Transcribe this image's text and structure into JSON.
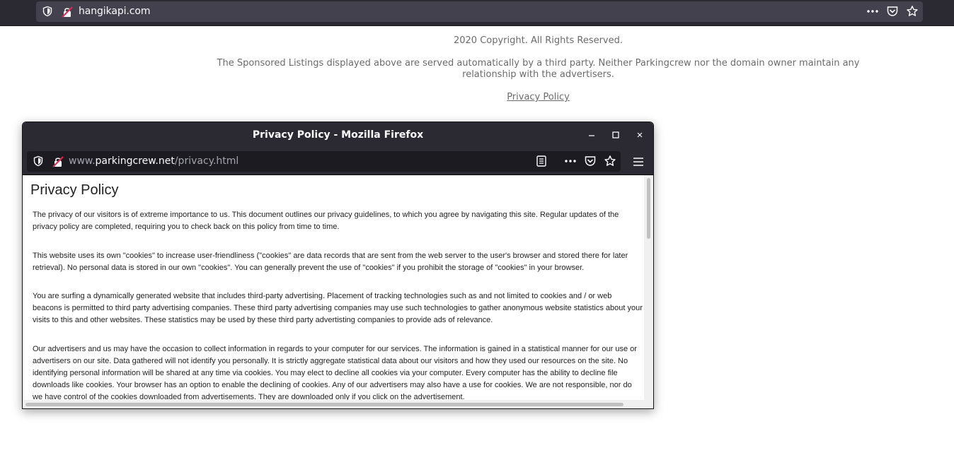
{
  "main_browser": {
    "url": "hangikapi.com",
    "icons": [
      "shield-icon",
      "insecure-lock-icon",
      "more-menu-icon",
      "pocket-icon",
      "bookmark-star-icon"
    ]
  },
  "background_page": {
    "copyright": "2020 Copyright. All Rights Reserved.",
    "disclaimer_line1": "The Sponsored Listings displayed above are served automatically by a third party. Neither Parkingcrew nor the domain owner maintain any",
    "disclaimer_line2": "relationship with the advertisers.",
    "privacy_link": "Privacy Policy"
  },
  "popup": {
    "title": "Privacy Policy - Mozilla Firefox",
    "url_prefix": "www.",
    "url_host": "parkingcrew.net",
    "url_path": "/privacy.html",
    "content": {
      "heading": "Privacy Policy",
      "paragraphs": [
        "The privacy of our visitors is of extreme importance to us. This document outlines our privacy guidelines, to which you agree by navigating this site. Regular updates of the privacy policy are completed, requiring you to check back on this policy from time to time.",
        "This website uses its own \"cookies\" to increase user-friendliness (\"cookies\" are data records that are sent from the web server to the user's browser and stored there for later retrieval). No personal data is stored in our own \"cookies\". You can generally prevent the use of \"cookies\" if you prohibit the storage of \"cookies\" in your browser.",
        "You are surfing a dynamically generated website that includes third-party advertising. Placement of tracking technologies such as and not limited to cookies and / or web beacons is permitted to third party advertising companies. These third party advertising companies may use such technologies to gather anonymous website statistics about your visits to this and other websites. These statistics may be used by these third party advertisting companies to provide ads of relevance.",
        "Our advertisers and us may have the occasion to collect information in regards to your computer for our services. The information is gained in a statistical manner for our use or advertisers on our site. Data gathered will not identify you personally. It is strictly aggregate statistical data about our visitors and how they used our resources on the site. No identifying personal information will be shared at any time via cookies. You may elect to decline all cookies via your computer. Every computer has the ability to decline file downloads like cookies. Your browser has an option to enable the declining of cookies. Any of our advertisers may also have a use for cookies. We are not responsible, nor do we have control of the cookies downloaded from advertisements. They are downloaded only if you click on the advertisement."
      ]
    }
  }
}
